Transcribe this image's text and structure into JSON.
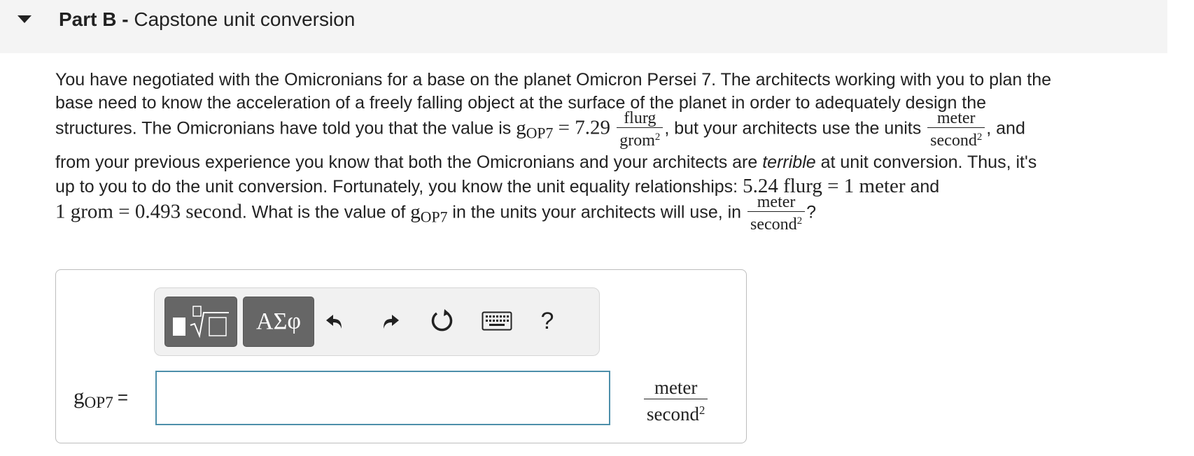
{
  "header": {
    "part_label": "Part B -",
    "part_title": "Capstone unit conversion"
  },
  "problem": {
    "l1": "You have negotiated with the Omicronians for a base on the planet Omicron Persei 7. The architects working with you to plan the",
    "l2": "base need to know the acceleration of a freely falling object at the surface of the planet in order to adequately design the",
    "l3a": "structures. The Omicronians have told you that the value is ",
    "g_sym": "g",
    "g_sub": "OP7",
    "eq_val": " = 7.29 ",
    "flurg": "flurg",
    "grom": "grom",
    "sq": "2",
    "l3b": ", but your architects use the units ",
    "meter": "meter",
    "second": "second",
    "l3c": ", and",
    "l4a": "from your previous experience you know that both the Omicronians and your architects are ",
    "l4_em": "terrible",
    "l4b": " at unit conversion. Thus, it's",
    "l5a": "up to you to do the unit conversion. Fortunately, you know the unit equality relationships: ",
    "rel1": "5.24 flurg = 1 meter",
    "l5b": " and",
    "rel2": "1 grom = 0.493 second",
    "l6a": ". What is the value of ",
    "l6b": " in the units your architects will use, in ",
    "l6c": "?"
  },
  "answer": {
    "equals": "=",
    "input_value": "",
    "unit_num": "meter",
    "unit_den": "second",
    "unit_exp": "2"
  },
  "toolbar": {
    "symbols_label": "ΑΣφ",
    "help_label": "?"
  },
  "icons": [
    "caret-down-icon",
    "templates-icon",
    "undo-icon",
    "redo-icon",
    "reset-icon",
    "keyboard-icon",
    "help-icon"
  ]
}
